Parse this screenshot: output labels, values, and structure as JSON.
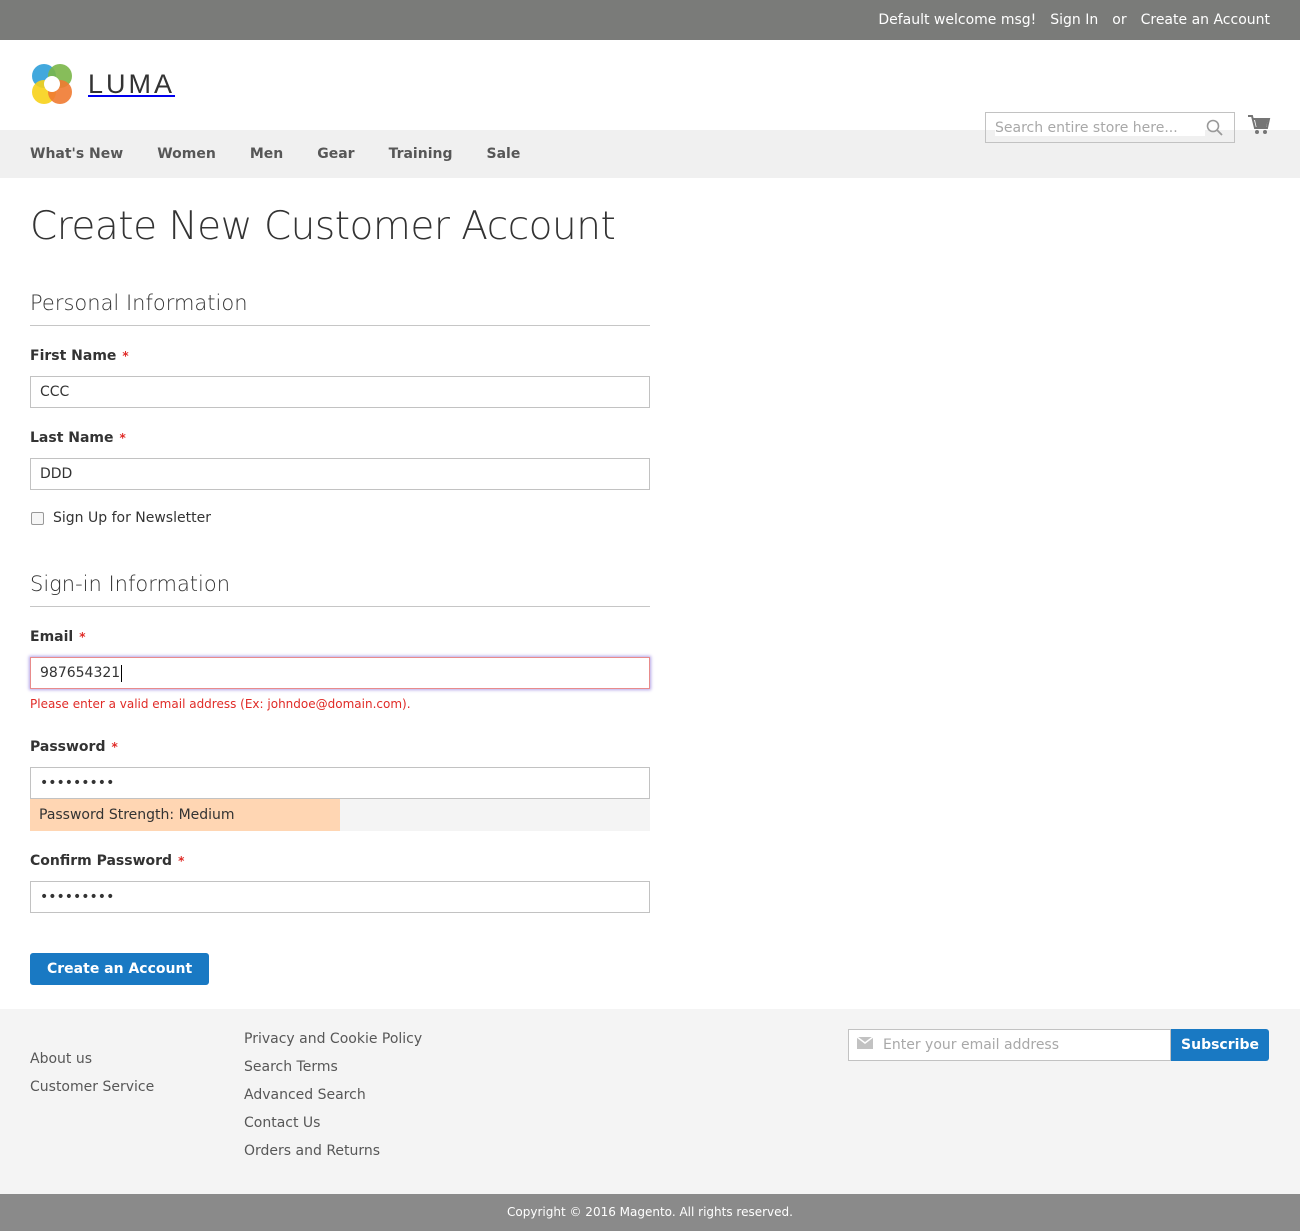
{
  "top_panel": {
    "welcome": "Default welcome msg!",
    "sign_in": "Sign In",
    "or": "or",
    "create_account": "Create an Account"
  },
  "header": {
    "logo_text": "LUMA",
    "search_placeholder": "Search entire store here...",
    "icons": {
      "search": "search-icon",
      "cart": "cart-icon"
    }
  },
  "nav": {
    "items": [
      "What's New",
      "Women",
      "Men",
      "Gear",
      "Training",
      "Sale"
    ]
  },
  "page": {
    "title": "Create New Customer Account",
    "personal": {
      "legend": "Personal Information",
      "first_name": {
        "label": "First Name",
        "value": "CCC",
        "required": "*"
      },
      "last_name": {
        "label": "Last Name",
        "value": "DDD",
        "required": "*"
      },
      "newsletter": {
        "label": "Sign Up for Newsletter",
        "checked": false
      }
    },
    "signin": {
      "legend": "Sign-in Information",
      "email": {
        "label": "Email",
        "value": "987654321",
        "required": "*",
        "error": "Please enter a valid email address (Ex: johndoe@domain.com)."
      },
      "password": {
        "label": "Password",
        "value": "•••••••••",
        "required": "*"
      },
      "strength": {
        "text": "Password Strength: Medium",
        "level_percent": 50,
        "color": "#ffd6b3"
      },
      "confirm": {
        "label": "Confirm Password",
        "value": "•••••••••",
        "required": "*"
      }
    },
    "submit_label": "Create an Account"
  },
  "footer": {
    "col1": [
      "About us",
      "Customer Service"
    ],
    "col2": [
      "Privacy and Cookie Policy",
      "Search Terms",
      "Advanced Search",
      "Contact Us",
      "Orders and Returns"
    ],
    "newsletter_placeholder": "Enter your email address",
    "subscribe_label": "Subscribe",
    "copyright": "Copyright © 2016 Magento. All rights reserved."
  },
  "colors": {
    "primary": "#1979c3",
    "error": "#e02b27",
    "panel": "#7a7b79"
  }
}
